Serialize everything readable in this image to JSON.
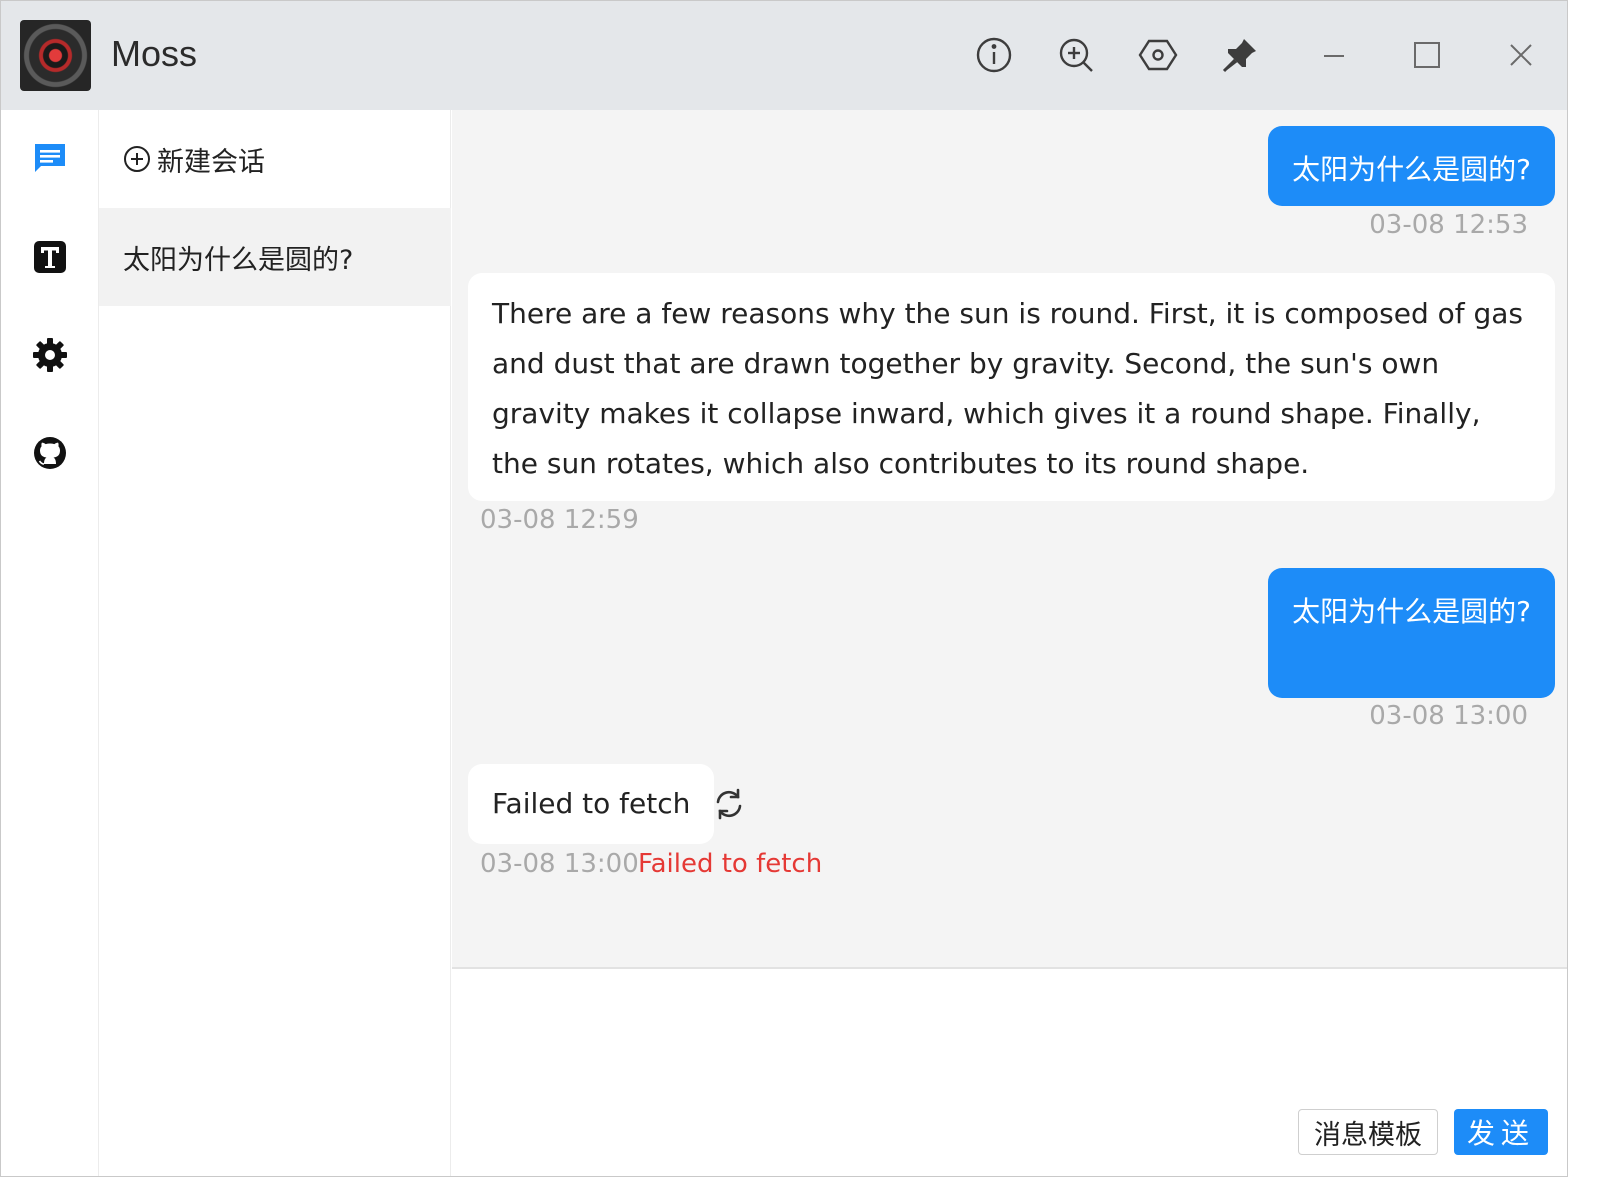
{
  "window": {
    "title": "Moss"
  },
  "sidebar_nav": {
    "items": [
      {
        "icon": "chat-icon",
        "active": true
      },
      {
        "icon": "template-icon",
        "active": false
      },
      {
        "icon": "settings-icon",
        "active": false
      },
      {
        "icon": "github-icon",
        "active": false
      }
    ]
  },
  "sessions": {
    "new_label": "新建会话",
    "items": [
      {
        "title": "太阳为什么是圆的?"
      }
    ]
  },
  "messages": [
    {
      "role": "user",
      "text": "太阳为什么是圆的?",
      "time": "03-08 12:53"
    },
    {
      "role": "assistant",
      "text": "There are a few reasons why the sun is round. First, it is composed of gas and dust that are drawn together by gravity. Second, the sun's own gravity makes it collapse inward, which gives it a round shape. Finally, the sun rotates, which also contributes to its round shape.",
      "time": "03-08 12:59"
    },
    {
      "role": "user",
      "text": "太阳为什么是圆的?",
      "time": "03-08 13:00"
    },
    {
      "role": "assistant",
      "text": "Failed to fetch",
      "time": "03-08 13:00",
      "error": "Failed to fetch"
    }
  ],
  "composer": {
    "value": "",
    "template_label": "消息模板",
    "send_label": "发送"
  },
  "colors": {
    "accent": "#1d8cf8",
    "error": "#e53935",
    "chat_bg": "#f4f4f4",
    "titlebar_bg": "#e4e7ea"
  }
}
